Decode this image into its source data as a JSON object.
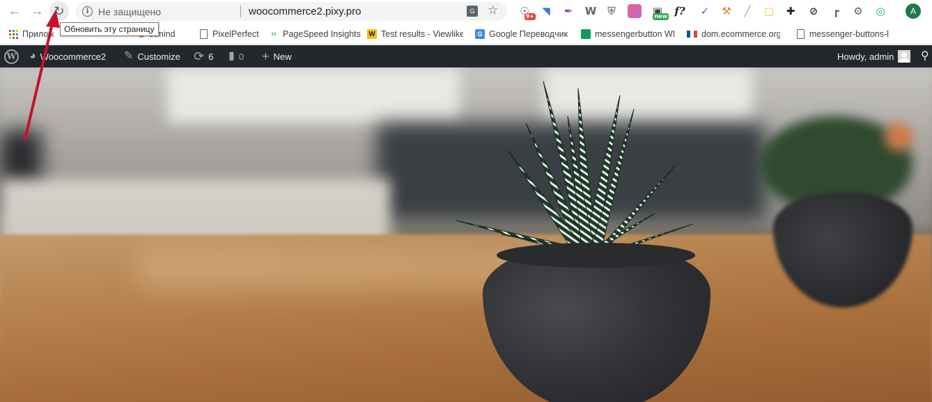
{
  "browser": {
    "security_label": "Не защищено",
    "url": "woocommerce2.pixy.pro",
    "reload_tooltip": "Обновить эту страницу",
    "info_glyph": "i",
    "avatar_letter": "A",
    "translate_glyph": "G",
    "extensions": [
      {
        "icon": "chromecast-badge-icon",
        "badge": "9+",
        "color": "#5f6368"
      },
      {
        "icon": "notion-icon",
        "color": "#3a7bd5"
      },
      {
        "icon": "pen-icon",
        "color": "#8e44ad"
      },
      {
        "icon": "wordpress-icon",
        "color": "#5f6368"
      },
      {
        "icon": "shield-icon",
        "color": "#7f8c8d"
      },
      {
        "icon": "gradient-icon",
        "color": "#d35aa0"
      },
      {
        "icon": "screenshot-icon",
        "badge": "new",
        "color": "#3c4043"
      },
      {
        "icon": "font-icon",
        "label": "f?",
        "color": "#202124"
      },
      {
        "icon": "color-picker-icon",
        "color": "#1a73e8"
      },
      {
        "icon": "hammer-icon",
        "color": "#e67e22"
      },
      {
        "icon": "ruler-icon",
        "color": "#95a5a6"
      },
      {
        "icon": "note-icon",
        "color": "#f1c40f"
      },
      {
        "icon": "move-icon",
        "color": "#202124"
      },
      {
        "icon": "speed-icon",
        "color": "#2c3e50"
      },
      {
        "icon": "corner-icon",
        "color": "#5f6368"
      },
      {
        "icon": "gear-icon",
        "color": "#5f6368"
      },
      {
        "icon": "chrome-target-icon",
        "color": "#27ae60"
      }
    ]
  },
  "bookmarks": [
    {
      "label": "Прилож",
      "icon": "apps-grid-icon"
    },
    {
      "label": "otmind",
      "icon": "hotmind-icon",
      "color": "#e67e22"
    },
    {
      "label": "PixelPerfect",
      "icon": "document-icon"
    },
    {
      "label": "PageSpeed Insights",
      "icon": "pagespeed-icon",
      "color": "#34a853"
    },
    {
      "label": "Test results - Viewlike",
      "icon": "viewlike-icon",
      "color": "#f4c20d"
    },
    {
      "label": "Google Переводчик",
      "icon": "google-translate-icon",
      "color": "#4285f4"
    },
    {
      "label": "messengerbutton WP",
      "icon": "sheets-icon",
      "color": "#0f9d58"
    },
    {
      "label": "dom.ecommerce.org",
      "icon": "french-flag-icon"
    },
    {
      "label": "messenger-buttons-l",
      "icon": "document-icon"
    }
  ],
  "adminbar": {
    "site_name": "Woocommerce2",
    "customize": "Customize",
    "updates_count": "6",
    "comments_count": "0",
    "new_label": "New",
    "howdy": "Howdy, admin",
    "wp_glyph": "W"
  },
  "colors": {
    "adminbar_bg": "#23282d",
    "annotation_arrow": "#c8102e"
  }
}
